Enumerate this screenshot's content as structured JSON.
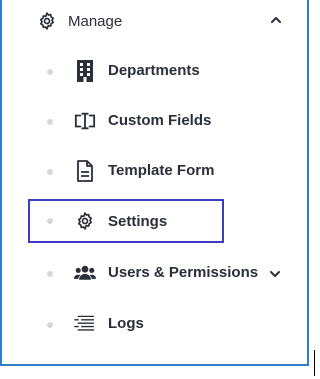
{
  "menu": {
    "section_label": "Manage",
    "items": [
      {
        "label": "Departments"
      },
      {
        "label": "Custom Fields"
      },
      {
        "label": "Template Form"
      },
      {
        "label": "Settings"
      },
      {
        "label": "Users & Permissions"
      },
      {
        "label": "Logs"
      }
    ]
  },
  "colors": {
    "panel_border": "#2f7ec9",
    "active_outline": "#3d3dc4",
    "text": "#2b2f3a",
    "bullet": "#d6d9de"
  },
  "icons": {
    "section": "gear-icon",
    "departments": "building-icon",
    "custom_fields": "text-cursor-icon",
    "template_form": "document-icon",
    "settings": "gear-icon",
    "users_permissions": "users-icon",
    "logs": "list-icon"
  }
}
